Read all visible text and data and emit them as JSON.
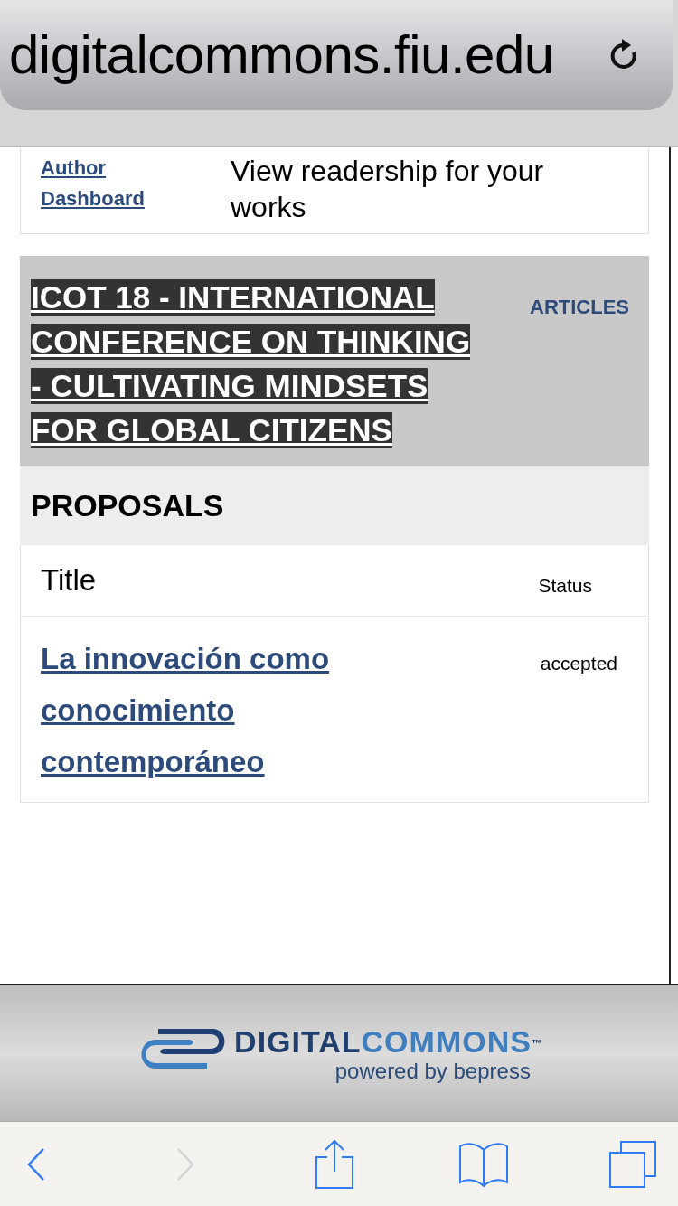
{
  "address_bar": {
    "url": "digitalcommons.fiu.edu"
  },
  "author_row": {
    "link_lines": [
      "Author",
      "Dashboard"
    ],
    "description": "View readership for your works"
  },
  "event": {
    "title_lines": [
      "ICOT 18 - INTERNATIONAL",
      "CONFERENCE ON THINKING",
      "- CULTIVATING MINDSETS",
      "FOR GLOBAL CITIZENS"
    ],
    "link": "ARTICLES"
  },
  "proposals": {
    "heading": "PROPOSALS",
    "columns": [
      "Title",
      "Status"
    ],
    "rows": [
      {
        "title": "La innovación como conocimiento contemporáneo",
        "status": "accepted"
      }
    ]
  },
  "footer_logo": {
    "word_1": "DIGITAL",
    "word_2": "COMMONS",
    "mark": "™",
    "tagline": "powered by bepress"
  },
  "toolbar": [
    {
      "kind": "back",
      "disabled": false
    },
    {
      "kind": "forward",
      "disabled": true
    },
    {
      "kind": "share",
      "disabled": false
    },
    {
      "kind": "bookmarks",
      "disabled": false
    },
    {
      "kind": "tabs",
      "disabled": false
    }
  ]
}
